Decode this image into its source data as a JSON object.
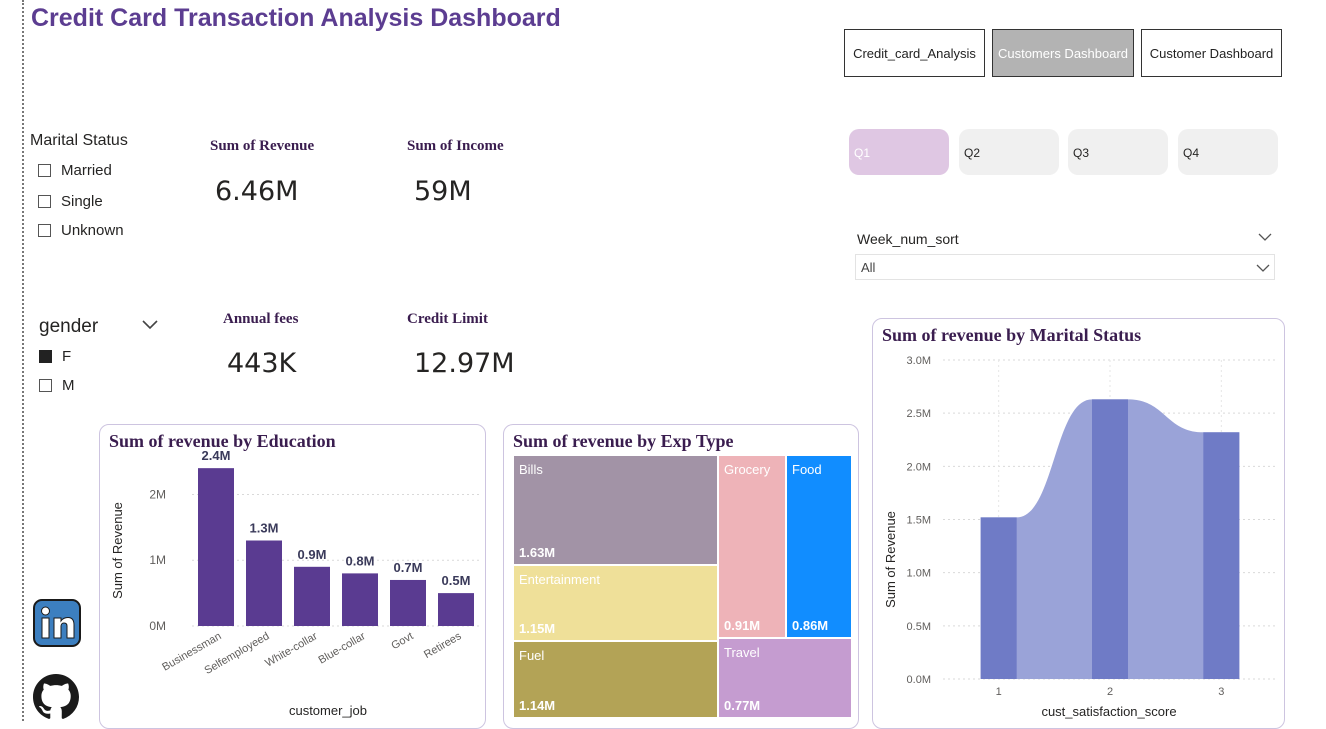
{
  "title": "Credit Card Transaction Analysis Dashboard",
  "nav_buttons": [
    {
      "label": "Credit_card_Analysis",
      "active": false
    },
    {
      "label": "Customers Dashboard",
      "active": true
    },
    {
      "label": "Customer Dashboard",
      "active": false
    }
  ],
  "marital_slicer": {
    "title": "Marital Status",
    "items": [
      {
        "label": "Married",
        "checked": false
      },
      {
        "label": "Single",
        "checked": false
      },
      {
        "label": "Unknown",
        "checked": false
      }
    ]
  },
  "gender_slicer": {
    "title": "gender",
    "items": [
      {
        "label": "F",
        "checked": true
      },
      {
        "label": "M",
        "checked": false
      }
    ]
  },
  "kpis": {
    "revenue": {
      "label": "Sum of Revenue",
      "value": "6.46M"
    },
    "income": {
      "label": "Sum of Income",
      "value": "59M"
    },
    "annual_fees": {
      "label": "Annual fees",
      "value": "443K"
    },
    "credit_limit": {
      "label": "Credit Limit",
      "value": "12.97M"
    }
  },
  "quarters": [
    {
      "label": "Q1",
      "active": true
    },
    {
      "label": "Q2",
      "active": false
    },
    {
      "label": "Q3",
      "active": false
    },
    {
      "label": "Q4",
      "active": false
    }
  ],
  "week_filter": {
    "label": "Week_num_sort",
    "value": "All"
  },
  "colors": {
    "accent_purple": "#5a3b91",
    "area_fill": "#9aa3d8",
    "area_bar": "#6f7bc6",
    "title_purple": "#5c3d91"
  },
  "social_icons": [
    "linkedin-icon",
    "github-icon"
  ],
  "chart_data": [
    {
      "type": "bar",
      "title": "Sum of revenue by Education",
      "xlabel": "customer_job",
      "ylabel": "Sum of Revenue",
      "categories": [
        "Businessman",
        "Selfemployeed",
        "White-collar",
        "Blue-collar",
        "Govt",
        "Retirees"
      ],
      "values": [
        2.4,
        1.3,
        0.9,
        0.8,
        0.7,
        0.5
      ],
      "data_labels": [
        "2.4M",
        "1.3M",
        "0.9M",
        "0.8M",
        "0.7M",
        "0.5M"
      ],
      "yticks": [
        "0M",
        "1M",
        "2M"
      ],
      "ylim": [
        0,
        2.6
      ],
      "unit": "M",
      "grid": true
    },
    {
      "type": "treemap",
      "title": "Sum of revenue by Exp Type",
      "items": [
        {
          "name": "Bills",
          "label": "1.63M",
          "value": 1.63,
          "color": "#a293a6"
        },
        {
          "name": "Entertainment",
          "label": "1.15M",
          "value": 1.15,
          "color": "#efe099"
        },
        {
          "name": "Fuel",
          "label": "1.14M",
          "value": 1.14,
          "color": "#b3a356"
        },
        {
          "name": "Grocery",
          "label": "0.91M",
          "value": 0.91,
          "color": "#eeb3b8"
        },
        {
          "name": "Food",
          "label": "0.86M",
          "value": 0.86,
          "color": "#118dff"
        },
        {
          "name": "Travel",
          "label": "0.77M",
          "value": 0.77,
          "color": "#c59cd0"
        }
      ]
    },
    {
      "type": "area",
      "title": "Sum of revenue by Marital Status",
      "xlabel": "cust_satisfaction_score",
      "ylabel": "Sum of Revenue",
      "x": [
        1,
        2,
        3
      ],
      "values": [
        1.52,
        2.63,
        2.32
      ],
      "yticks": [
        "0.0M",
        "0.5M",
        "1.0M",
        "1.5M",
        "2.0M",
        "2.5M",
        "3.0M"
      ],
      "ylim": [
        0,
        3.0
      ],
      "grid": true
    }
  ]
}
